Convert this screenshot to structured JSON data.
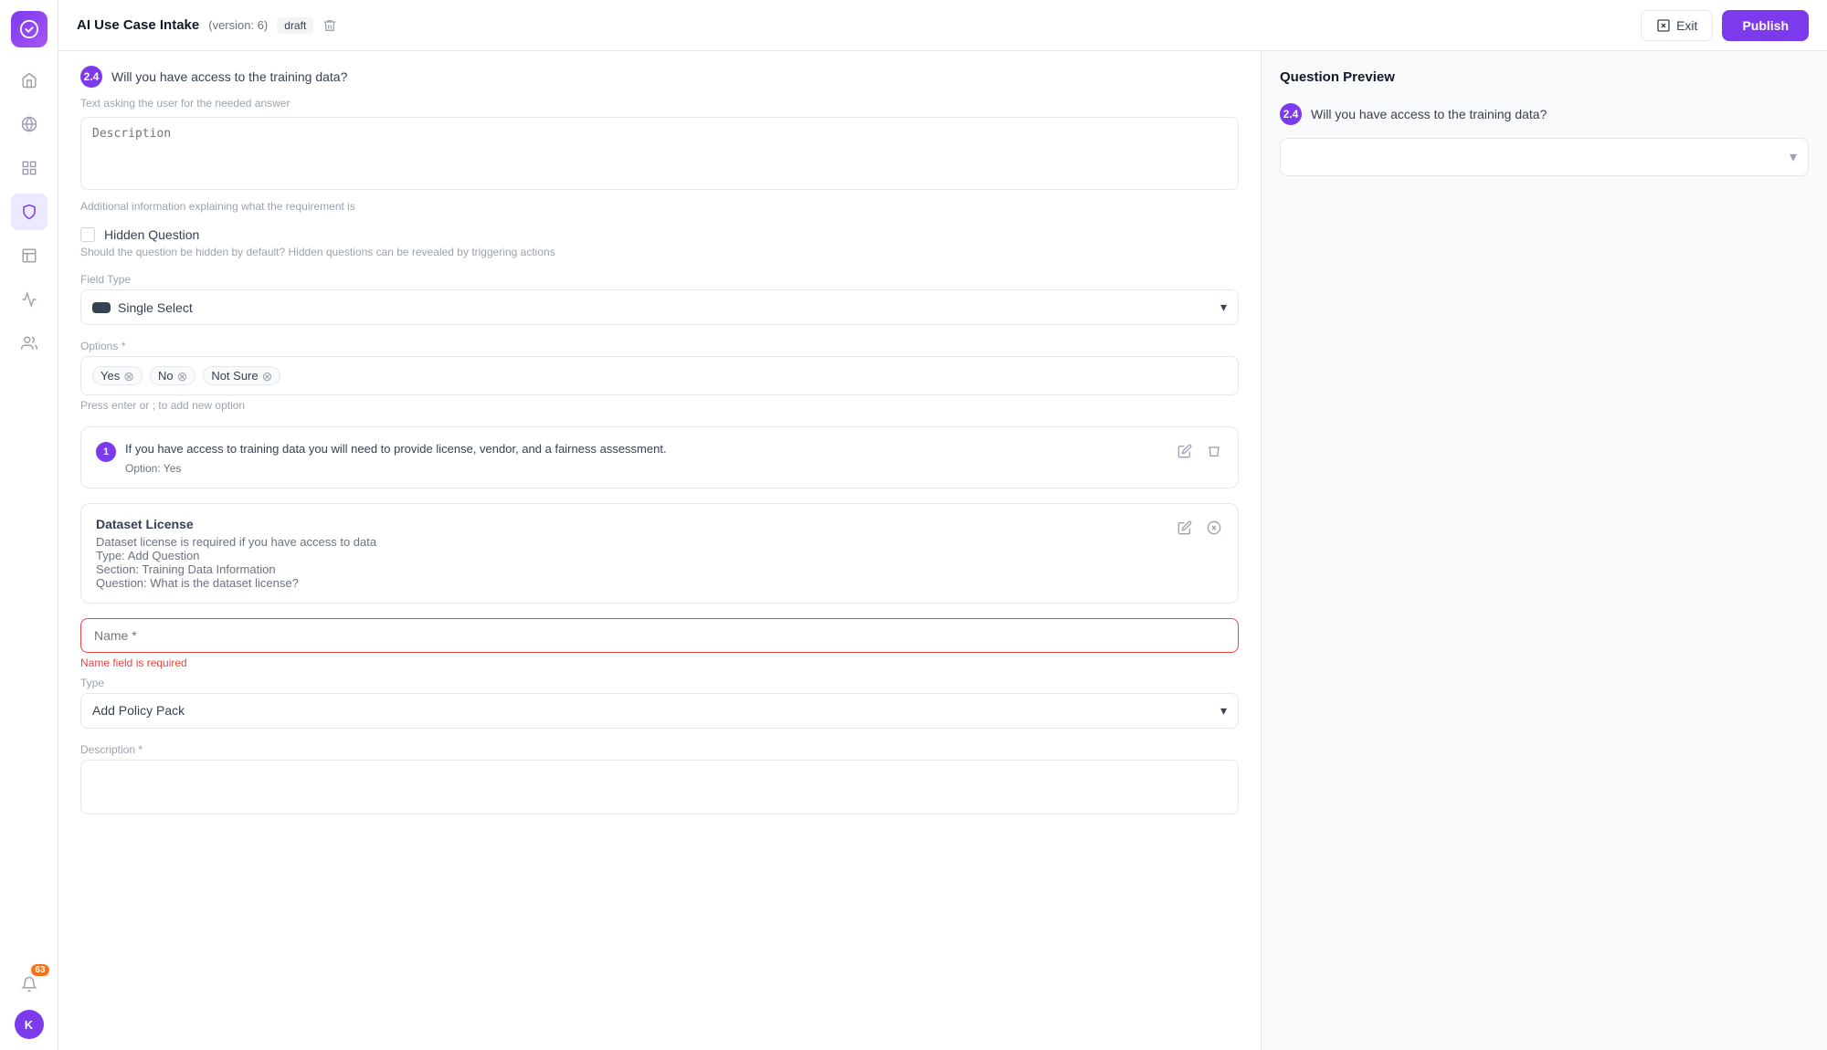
{
  "app": {
    "title": "AI Use Case Intake",
    "version": "(version: 6)",
    "status": "draft"
  },
  "topbar": {
    "exit_label": "Exit",
    "publish_label": "Publish"
  },
  "sidebar": {
    "items": [
      {
        "id": "home",
        "icon": "home-icon"
      },
      {
        "id": "globe",
        "icon": "globe-icon"
      },
      {
        "id": "grid",
        "icon": "grid-icon"
      },
      {
        "id": "shield",
        "icon": "shield-icon",
        "active": true
      },
      {
        "id": "layout",
        "icon": "layout-icon"
      },
      {
        "id": "activity",
        "icon": "activity-icon"
      },
      {
        "id": "users",
        "icon": "users-icon"
      }
    ],
    "notification_count": "63",
    "avatar_initials": "K"
  },
  "form": {
    "question_badge": "2.4",
    "question_text": "Will you have access to the training data?",
    "answer_placeholder": "Text asking the user for the needed answer",
    "description_placeholder": "Description",
    "description_hint": "Additional information explaining what the requirement is",
    "hidden_question_label": "Hidden Question",
    "hidden_question_desc": "Should the question be hidden by default? Hidden questions can be revealed by triggering actions",
    "field_type_label": "Field Type",
    "field_type_value": "Single Select",
    "options_label": "Options *",
    "options": [
      {
        "label": "Yes"
      },
      {
        "label": "No"
      },
      {
        "label": "Not Sure"
      }
    ],
    "options_hint": "Press enter or ; to add new option",
    "action_number": "1",
    "action_text": "If you have access to training data you will need to provide license, vendor, and a fairness assessment.",
    "action_option": "Option: Yes",
    "dataset_card": {
      "title": "Dataset License",
      "description": "Dataset license is required if you have access to data",
      "type_label": "Type: Add Question",
      "section_label": "Section: Training Data Information",
      "question_label": "Question: What is the dataset license?"
    },
    "name_label": "Name *",
    "name_error": "Name field is required",
    "type_label": "Type",
    "type_value": "Add Policy Pack",
    "description2_label": "Description *"
  },
  "preview": {
    "title": "Question Preview",
    "question_badge": "2.4",
    "question_text": "Will you have access to the training data?"
  }
}
